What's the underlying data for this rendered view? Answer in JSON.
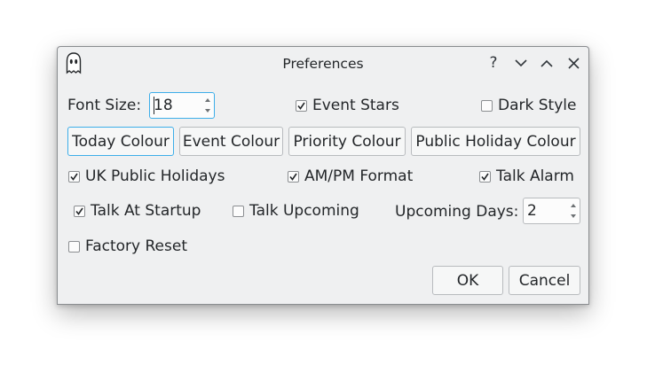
{
  "window": {
    "title": "Preferences",
    "icons": [
      "ghost-icon",
      "help-icon",
      "minimize-icon",
      "maximize-icon",
      "close-icon"
    ],
    "help_glyph": "?"
  },
  "font_size": {
    "label": "Font Size:",
    "value": "18"
  },
  "toggles": {
    "event_stars": {
      "label": "Event Stars",
      "checked": true
    },
    "dark_style": {
      "label": "Dark Style",
      "checked": false
    },
    "uk_public_holidays": {
      "label": "UK Public Holidays",
      "checked": true
    },
    "am_pm_format": {
      "label": "AM/PM Format",
      "checked": true
    },
    "talk_alarm": {
      "label": "Talk Alarm",
      "checked": true
    },
    "talk_at_startup": {
      "label": "Talk At Startup",
      "checked": true
    },
    "talk_upcoming": {
      "label": "Talk Upcoming",
      "checked": false
    },
    "factory_reset": {
      "label": "Factory Reset",
      "checked": false
    }
  },
  "colour_buttons": {
    "today": "Today Colour",
    "event": "Event Colour",
    "priority": "Priority Colour",
    "public_holiday": "Public Holiday Colour"
  },
  "upcoming_days": {
    "label": "Upcoming Days:",
    "value": "2"
  },
  "buttons": {
    "ok": "OK",
    "cancel": "Cancel"
  },
  "colors": {
    "focus": "#3daee9",
    "dialog_bg": "#eff0f1",
    "text": "#232629"
  }
}
